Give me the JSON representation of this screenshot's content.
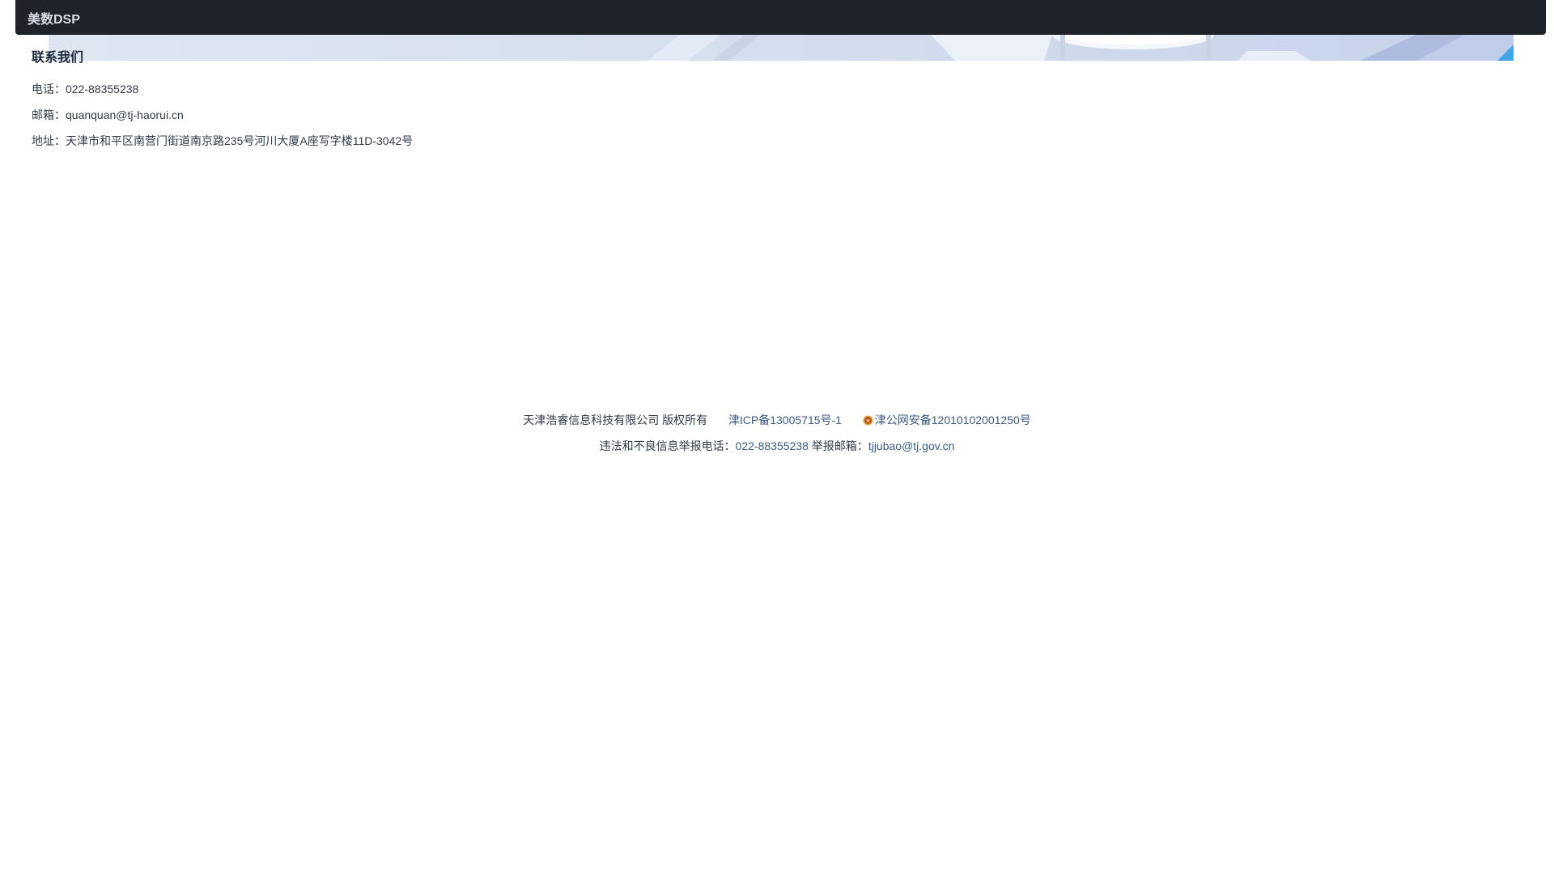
{
  "navbar": {
    "brand": "美数DSP"
  },
  "contact": {
    "title": "联系我们",
    "phone": "电话：022-88355238",
    "email": "邮箱：quanquan@tj-haorui.cn",
    "address": "地址：天津市和平区南营门街道南京路235号河川大厦A座写字楼11D-3042号"
  },
  "footer": {
    "copyright": "天津浩睿信息科技有限公司 版权所有",
    "icp": "津ICP备13005715号-1",
    "police_icon": "police-badge-icon",
    "police": "津公网安备12010102001250号",
    "report_phone_label": "违法和不良信息举报电话：",
    "report_phone": "022-88355238",
    "report_email_label": " 举报邮箱：",
    "report_email": "tjjubao@tj.gov.cn"
  },
  "colors": {
    "navbar_bg": "#1f2329",
    "link": "#3a5a85",
    "text": "#303a46"
  }
}
